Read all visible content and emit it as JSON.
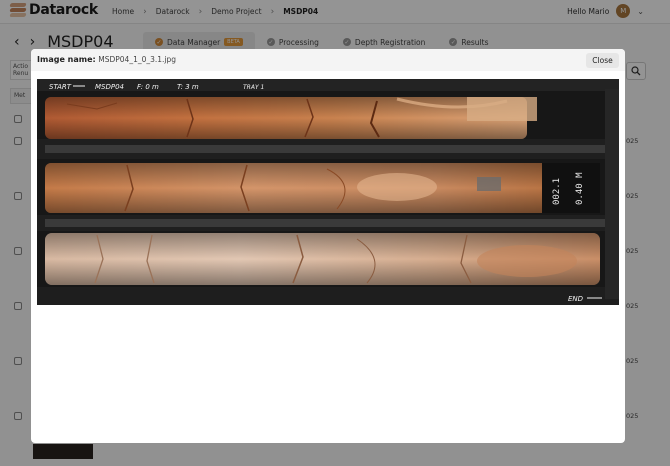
{
  "app": {
    "logo_text": "Datarock",
    "breadcrumbs": [
      "Home",
      "Datarock",
      "Demo Project",
      "MSDP04"
    ],
    "user_greeting": "Hello Mario",
    "user_initial": "M",
    "page_title": "MSDP04",
    "left_labels": [
      "Actio",
      "Renu",
      "Met"
    ],
    "tabs": [
      {
        "label": "Data Manager",
        "badge": "BETA",
        "active": true
      },
      {
        "label": "Processing",
        "active": false
      },
      {
        "label": "Depth Registration",
        "active": false
      },
      {
        "label": "Results",
        "active": false
      }
    ],
    "row_year_fragment": "025"
  },
  "modal": {
    "image_name_label": "Image name:",
    "image_name_value": "MSDP04_1_0_3.1.jpg",
    "close_label": "Close",
    "photo": {
      "header_texts": [
        "START",
        "MSDP04",
        "F: 0 m",
        "T: 3 m",
        "TRAY 1"
      ],
      "side_labels": [
        "002.1",
        "0.40 M"
      ],
      "end_text": "END",
      "colors": {
        "tray": "#1c1c1c",
        "core_red": "#b9653a",
        "core_orange": "#c98650",
        "core_pale": "#d9b79c"
      }
    }
  }
}
